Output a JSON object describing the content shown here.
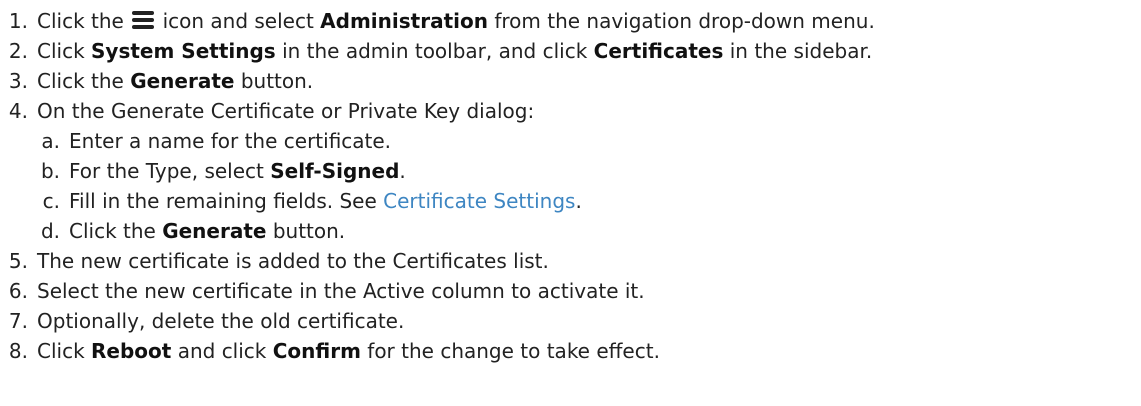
{
  "steps": {
    "s1": {
      "num": "1.",
      "t1": "Click the",
      "icon": "hamburger-menu-icon",
      "t2": "icon and select",
      "b1": "Administration",
      "t3": "from the navigation drop-down menu."
    },
    "s2": {
      "num": "2.",
      "t1": "Click",
      "b1": "System Settings",
      "t2": "in the admin toolbar, and click",
      "b2": "Certificates",
      "t3": "in the sidebar."
    },
    "s3": {
      "num": "3.",
      "t1": "Click the",
      "b1": "Generate",
      "t2": "button."
    },
    "s4": {
      "num": "4.",
      "t1": "On the Generate Certificate or Private Key dialog:",
      "a": {
        "num": "a.",
        "t1": "Enter a name for the certificate."
      },
      "b": {
        "num": "b.",
        "t1": "For the Type, select",
        "b1": "Self-Signed",
        "t2": "."
      },
      "c": {
        "num": "c.",
        "t1": "Fill in the remaining fields. See",
        "link": "Certificate Settings",
        "t2": "."
      },
      "d": {
        "num": "d.",
        "t1": "Click the",
        "b1": "Generate",
        "t2": "button."
      }
    },
    "s5": {
      "num": "5.",
      "t1": "The new certificate is added to the Certificates list."
    },
    "s6": {
      "num": "6.",
      "t1": "Select the new certificate in the Active column to activate it."
    },
    "s7": {
      "num": "7.",
      "t1": "Optionally, delete the old certificate."
    },
    "s8": {
      "num": "8.",
      "t1": "Click",
      "b1": "Reboot",
      "t2": "and click",
      "b2": "Confirm",
      "t3": "for the change to take effect."
    }
  },
  "colors": {
    "text": "#222222",
    "link": "#3e86c2"
  }
}
